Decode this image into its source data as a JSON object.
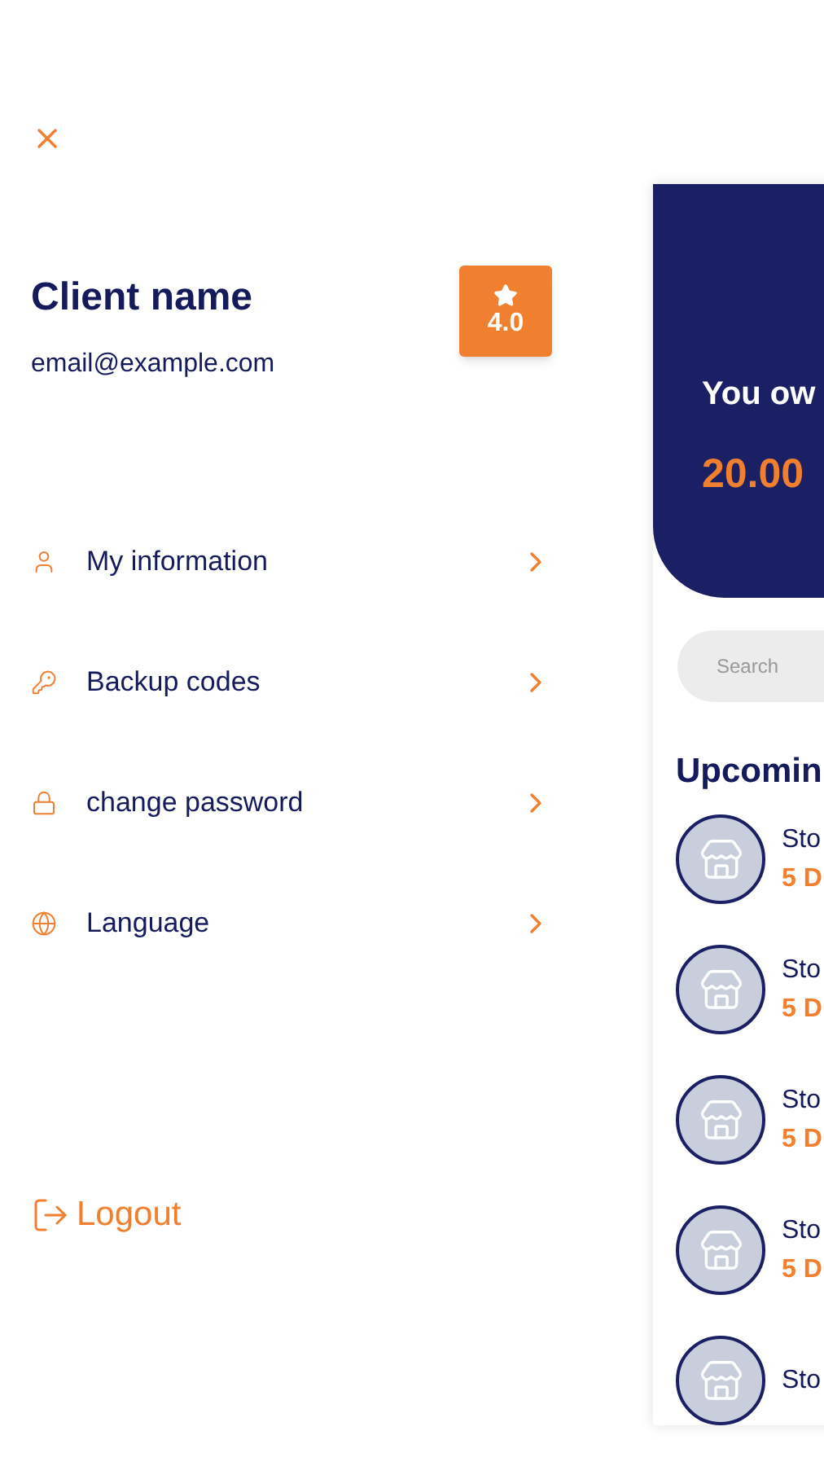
{
  "drawer": {
    "client_name": "Client name",
    "email": "email@example.com",
    "rating": "4.0",
    "menu": [
      {
        "kind": "user",
        "label": "My information"
      },
      {
        "kind": "key",
        "label": "Backup codes"
      },
      {
        "kind": "lock",
        "label": "change password"
      },
      {
        "kind": "globe",
        "label": "Language"
      }
    ],
    "logout": "Logout"
  },
  "preview": {
    "balance_label": "You ow",
    "balance": "20.00",
    "search": {
      "placeholder": "Search"
    },
    "section_title": "Upcomin",
    "items": [
      {
        "name": "Sto",
        "detail": "5 D"
      },
      {
        "name": "Sto",
        "detail": "5 D"
      },
      {
        "name": "Sto",
        "detail": "5 D"
      },
      {
        "name": "Sto",
        "detail": "5 D"
      },
      {
        "name": "Sto"
      }
    ]
  }
}
